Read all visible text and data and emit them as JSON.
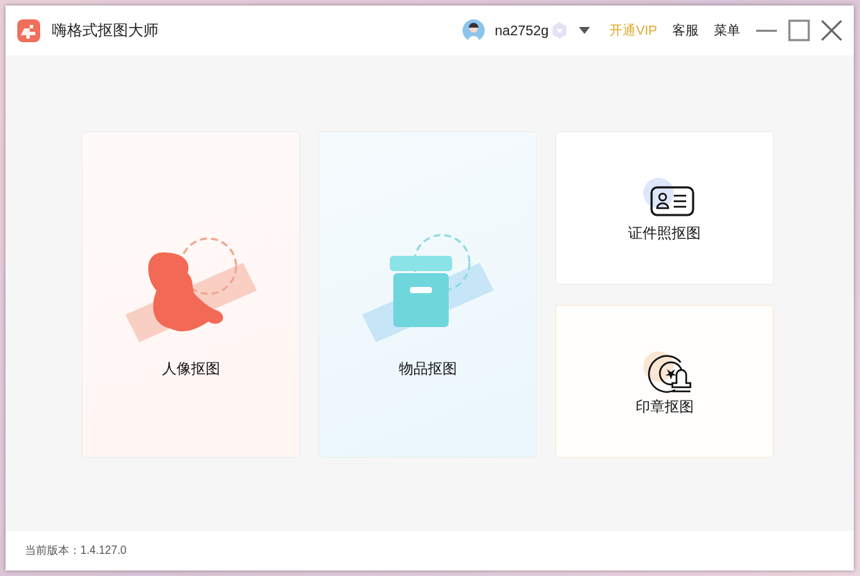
{
  "window": {
    "title": "嗨格式抠图大师"
  },
  "header": {
    "username": "na2752g",
    "vip_link": "开通VIP",
    "service_link": "客服",
    "menu_link": "菜单"
  },
  "cards": [
    {
      "label": "人像抠图",
      "kind": "large"
    },
    {
      "label": "物品抠图",
      "kind": "large"
    },
    {
      "label": "证件照抠图",
      "kind": "small"
    },
    {
      "label": "印章抠图",
      "kind": "small"
    }
  ],
  "status_bar": {
    "version_label": "当前版本：",
    "version": "1.4.127.0"
  }
}
